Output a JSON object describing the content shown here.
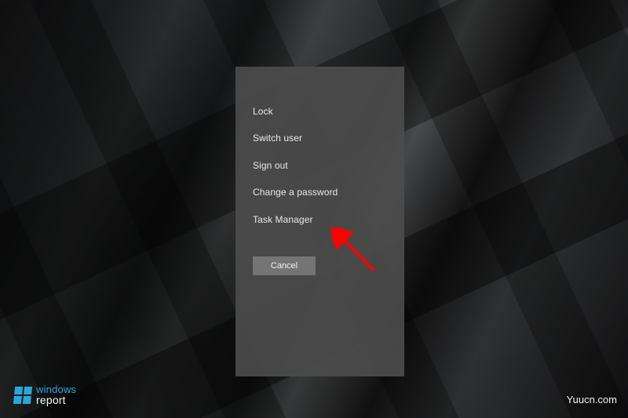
{
  "menu": {
    "items": [
      {
        "label": "Lock"
      },
      {
        "label": "Switch user"
      },
      {
        "label": "Sign out"
      },
      {
        "label": "Change a password"
      },
      {
        "label": "Task Manager"
      }
    ],
    "cancel_label": "Cancel"
  },
  "watermarks": {
    "left_line1": "windows",
    "left_line2": "report",
    "right": "Yuucn.com"
  },
  "annotation": {
    "arrow_color": "#ff0000"
  }
}
